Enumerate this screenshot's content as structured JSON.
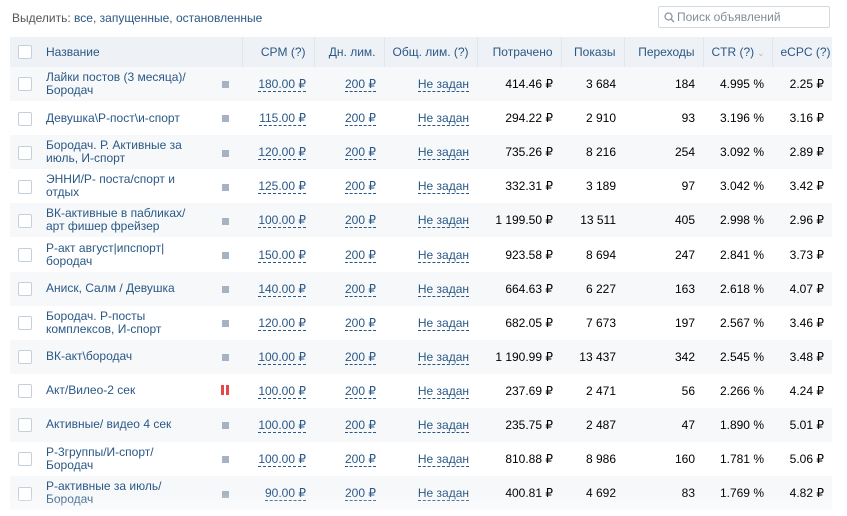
{
  "filter": {
    "label": "Выделить:",
    "options": [
      "все",
      "запущенные",
      "остановленные"
    ],
    "separator": ", "
  },
  "search": {
    "placeholder": "Поиск объявлений",
    "icon": "search-icon"
  },
  "table": {
    "columns": {
      "name": "Название",
      "cpm": "CPM (?)",
      "day_limit": "Дн. лим.",
      "total_limit": "Общ. лим. (?)",
      "spent": "Потрачено",
      "impressions": "Показы",
      "clicks": "Переходы",
      "ctr": "CTR (?)",
      "ecpc": "eCPC (?)"
    },
    "ctr_sort_icon": "⌄",
    "rows": [
      {
        "name": "Лайки постов (3 месяца)/ Бородач",
        "status": "stopped",
        "cpm": "180.00 ₽",
        "day_limit": "200 ₽",
        "total_limit": "Не задан",
        "spent": "414.46 ₽",
        "impressions": "3 684",
        "clicks": "184",
        "ctr": "4.995 %",
        "ecpc": "2.25 ₽"
      },
      {
        "name": "Девушка\\Р-пост\\и-спорт",
        "status": "stopped",
        "cpm": "115.00 ₽",
        "day_limit": "200 ₽",
        "total_limit": "Не задан",
        "spent": "294.22 ₽",
        "impressions": "2 910",
        "clicks": "93",
        "ctr": "3.196 %",
        "ecpc": "3.16 ₽"
      },
      {
        "name": "Бородач. Р. Активные за июль, И-спорт",
        "status": "stopped",
        "cpm": "120.00 ₽",
        "day_limit": "200 ₽",
        "total_limit": "Не задан",
        "spent": "735.26 ₽",
        "impressions": "8 216",
        "clicks": "254",
        "ctr": "3.092 %",
        "ecpc": "2.89 ₽"
      },
      {
        "name": "ЭННИ/Р- поста/спорт и отдых",
        "status": "stopped",
        "cpm": "125.00 ₽",
        "day_limit": "200 ₽",
        "total_limit": "Не задан",
        "spent": "332.31 ₽",
        "impressions": "3 189",
        "clicks": "97",
        "ctr": "3.042 %",
        "ecpc": "3.42 ₽"
      },
      {
        "name": "ВК-активные в пабликах/ арт фишер фрейзер",
        "status": "stopped",
        "cpm": "100.00 ₽",
        "day_limit": "200 ₽",
        "total_limit": "Не задан",
        "spent": "1 199.50 ₽",
        "impressions": "13 511",
        "clicks": "405",
        "ctr": "2.998 %",
        "ecpc": "2.96 ₽"
      },
      {
        "name": "Р-акт август|ипспорт| бородач",
        "status": "stopped",
        "cpm": "150.00 ₽",
        "day_limit": "200 ₽",
        "total_limit": "Не задан",
        "spent": "923.58 ₽",
        "impressions": "8 694",
        "clicks": "247",
        "ctr": "2.841 %",
        "ecpc": "3.73 ₽"
      },
      {
        "name": "Аниск, Салм / Девушка",
        "status": "stopped",
        "cpm": "140.00 ₽",
        "day_limit": "200 ₽",
        "total_limit": "Не задан",
        "spent": "664.63 ₽",
        "impressions": "6 227",
        "clicks": "163",
        "ctr": "2.618 %",
        "ecpc": "4.07 ₽"
      },
      {
        "name": "Бородач. Р-посты комплексов, И-спорт",
        "status": "stopped",
        "cpm": "120.00 ₽",
        "day_limit": "200 ₽",
        "total_limit": "Не задан",
        "spent": "682.05 ₽",
        "impressions": "7 673",
        "clicks": "197",
        "ctr": "2.567 %",
        "ecpc": "3.46 ₽"
      },
      {
        "name": "ВК-акт\\бородач",
        "status": "stopped",
        "cpm": "100.00 ₽",
        "day_limit": "200 ₽",
        "total_limit": "Не задан",
        "spent": "1 190.99 ₽",
        "impressions": "13 437",
        "clicks": "342",
        "ctr": "2.545 %",
        "ecpc": "3.48 ₽"
      },
      {
        "name": "Акт/Вилео-2 сек",
        "status": "paused",
        "cpm": "100.00 ₽",
        "day_limit": "200 ₽",
        "total_limit": "Не задан",
        "spent": "237.69 ₽",
        "impressions": "2 471",
        "clicks": "56",
        "ctr": "2.266 %",
        "ecpc": "4.24 ₽"
      },
      {
        "name": "Активные/ видео 4 сек",
        "status": "stopped",
        "cpm": "100.00 ₽",
        "day_limit": "200 ₽",
        "total_limit": "Не задан",
        "spent": "235.75 ₽",
        "impressions": "2 487",
        "clicks": "47",
        "ctr": "1.890 %",
        "ecpc": "5.01 ₽"
      },
      {
        "name": "Р-3группы/И-спорт/ Бородач",
        "status": "stopped",
        "cpm": "100.00 ₽",
        "day_limit": "200 ₽",
        "total_limit": "Не задан",
        "spent": "810.88 ₽",
        "impressions": "8 986",
        "clicks": "160",
        "ctr": "1.781 %",
        "ecpc": "5.06 ₽"
      },
      {
        "name": "Р-активные за июль/ Бородач",
        "status": "stopped",
        "cpm": "90.00 ₽",
        "day_limit": "200 ₽",
        "total_limit": "Не задан",
        "spent": "400.81 ₽",
        "impressions": "4 692",
        "clicks": "83",
        "ctr": "1.769 %",
        "ecpc": "4.82 ₽"
      }
    ]
  },
  "colors": {
    "link": "#2a5885",
    "header_bg": "#eef1f5",
    "status_stopped": "#a5b3c2",
    "status_paused": "#e64646"
  }
}
